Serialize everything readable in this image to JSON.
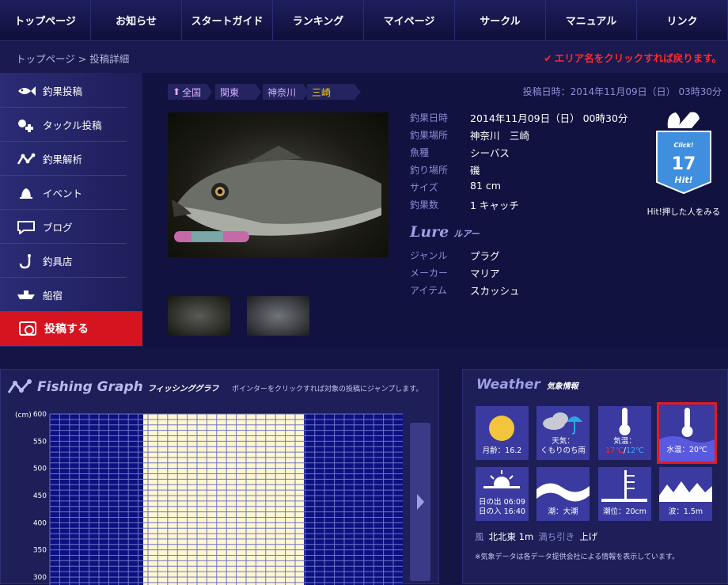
{
  "nav": [
    "トップページ",
    "お知らせ",
    "スタートガイド",
    "ランキング",
    "マイページ",
    "サークル",
    "マニュアル",
    "リンク"
  ],
  "breadcrumb": {
    "home": "トップページ",
    "sep": " > ",
    "current": "投稿詳細"
  },
  "notice": "エリア名をクリックすれば戻ります。",
  "sidebar": [
    {
      "label": "釣果投稿",
      "icon": "fish-icon"
    },
    {
      "label": "タックル投稿",
      "icon": "tackle-icon"
    },
    {
      "label": "釣果解析",
      "icon": "graph-icon"
    },
    {
      "label": "イベント",
      "icon": "bell-icon"
    },
    {
      "label": "ブログ",
      "icon": "speech-bubble-icon"
    },
    {
      "label": "釣具店",
      "icon": "hook-icon"
    },
    {
      "label": "船宿",
      "icon": "boat-icon"
    }
  ],
  "post_button": "投稿する",
  "areas": [
    "全国",
    "関東",
    "神奈川",
    "三崎"
  ],
  "posted_at": "投稿日時：2014年11月09日（日） 03時30分",
  "details": [
    {
      "label": "釣果日時",
      "value": "2014年11月09日（日） 00時30分"
    },
    {
      "label": "釣果場所",
      "value": "神奈川　三崎"
    },
    {
      "label": "魚種",
      "value": "シーバス"
    },
    {
      "label": "釣り場所",
      "value": "磯"
    },
    {
      "label": "サイズ",
      "value": "81 cm"
    },
    {
      "label": "釣果数",
      "value": "1 キャッチ"
    }
  ],
  "lure": {
    "title": "Lure",
    "subtitle": "ルアー"
  },
  "lure_details": [
    {
      "label": "ジャンル",
      "value": "プラグ"
    },
    {
      "label": "メーカー",
      "value": "マリア"
    },
    {
      "label": "アイテム",
      "value": "スカッシュ"
    }
  ],
  "hit": {
    "click": "Click!",
    "count": "17",
    "word": "Hit!",
    "caption": "Hit!押した人をみる"
  },
  "graph": {
    "title": "Fishing Graph",
    "subtitle": "フィッシンググラフ",
    "note": "ポインターをクリックすれば対象の投稿にジャンプします。"
  },
  "chart_data": {
    "type": "scatter",
    "ylabel": "(cm)",
    "y_ticks": [
      600,
      550,
      500,
      450,
      400,
      350,
      300
    ],
    "ylim": [
      300,
      600
    ],
    "points": [],
    "highlight_band": true
  },
  "weather": {
    "title": "Weather",
    "subtitle": "気象情報",
    "moon": "月齢：16.2",
    "sky_label": "天気：",
    "sky": "くもりのち雨",
    "air_label": "気温：",
    "air_hi": "17℃",
    "air_sep": "/",
    "air_lo": "12℃",
    "water": "水温：20℃",
    "sunrise": "日の出 06:09",
    "sunset": "日の入 16:40",
    "tide": "潮：大潮",
    "tide_level": "潮位：20cm",
    "wave": "波：1.5m",
    "wind_label": "風",
    "wind": "北北東 1m",
    "flow_label": "満ち引き",
    "flow": "上げ",
    "note": "※気象データは各データ提供会社による情報を表示しています。",
    "colors": {
      "tile": "#3a3aa0",
      "highlight": "#e11b22",
      "hi_temp": "#ff3030",
      "lo_temp": "#35b0ff"
    }
  }
}
